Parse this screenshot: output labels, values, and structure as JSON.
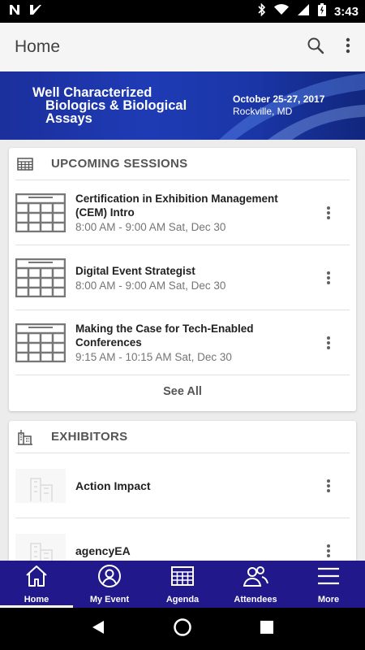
{
  "status_bar": {
    "time": "3:43"
  },
  "app_bar": {
    "title": "Home"
  },
  "banner": {
    "title_lines": [
      "Well Characterized",
      "Biologics & Biological",
      "Assays"
    ],
    "date": "October 25-27, 2017",
    "location": "Rockville, MD"
  },
  "sessions": {
    "header": "UPCOMING SESSIONS",
    "items": [
      {
        "title": "Certification in Exhibition Management (CEM) Intro",
        "time": "8:00 AM - 9:00 AM Sat, Dec 30"
      },
      {
        "title": "Digital Event Strategist",
        "time": "8:00 AM - 9:00 AM Sat, Dec 30"
      },
      {
        "title": "Making the Case for Tech-Enabled Conferences",
        "time": "9:15 AM - 10:15 AM Sat, Dec 30"
      }
    ],
    "see_all": "See All"
  },
  "exhibitors": {
    "header": "EXHIBITORS",
    "items": [
      {
        "name": "Action Impact"
      },
      {
        "name": "agencyEA"
      }
    ]
  },
  "bottom_nav": {
    "items": [
      {
        "label": "Home",
        "icon": "home-icon",
        "active": true
      },
      {
        "label": "My Event",
        "icon": "person-icon",
        "active": false
      },
      {
        "label": "Agenda",
        "icon": "calendar-icon",
        "active": false
      },
      {
        "label": "Attendees",
        "icon": "people-icon",
        "active": false
      },
      {
        "label": "More",
        "icon": "menu-icon",
        "active": false
      }
    ]
  },
  "colors": {
    "nav_background": "#21188c",
    "banner_blue": "#1e3bb5"
  }
}
